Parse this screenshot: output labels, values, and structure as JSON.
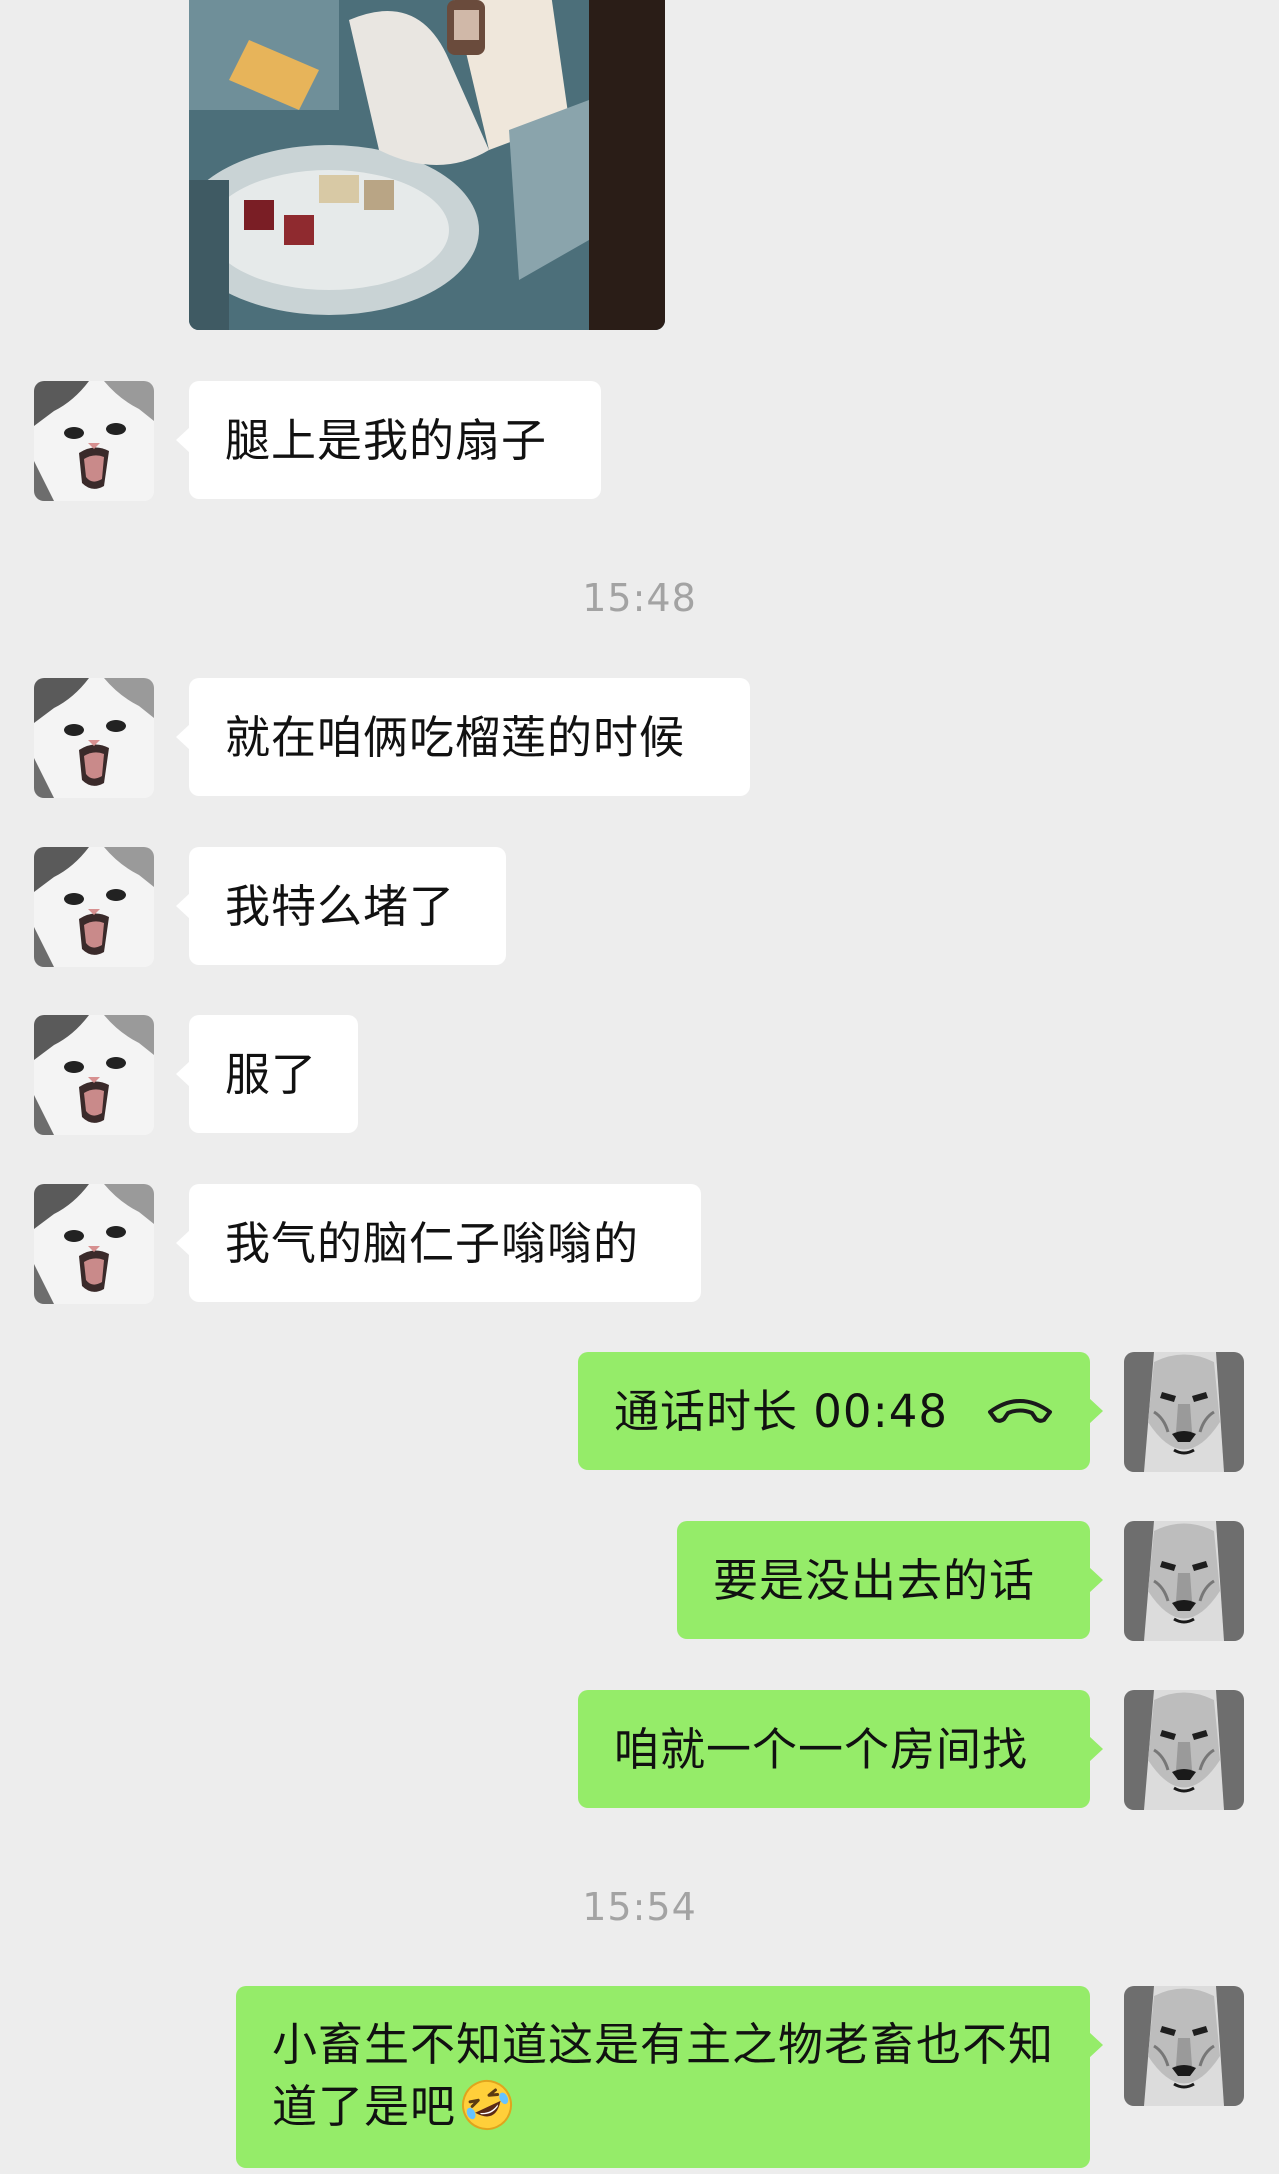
{
  "chat": {
    "timestamps": [
      "15:48",
      "15:54"
    ],
    "messages": [
      {
        "from": "contact",
        "text": "腿上是我的扇子"
      },
      {
        "from": "contact",
        "text": "就在咱俩吃榴莲的时候"
      },
      {
        "from": "contact",
        "text": "我特么堵了"
      },
      {
        "from": "contact",
        "text": "服了"
      },
      {
        "from": "contact",
        "text": "我气的脑仁子嗡嗡的"
      },
      {
        "from": "me",
        "type": "call",
        "text": "通话时长 00:48",
        "icon": "phone-hangup-icon"
      },
      {
        "from": "me",
        "text": "要是没出去的话"
      },
      {
        "from": "me",
        "text": "咱就一个一个房间找"
      },
      {
        "from": "me",
        "text": "小畜生不知道这是有主之物老畜也不知道了是吧",
        "emoji": "rolling-on-floor-laughing"
      }
    ]
  },
  "avatars": {
    "contact": "cat-avatar",
    "me": "lion-avatar"
  },
  "colors": {
    "background": "#ededed",
    "incoming_bubble": "#ffffff",
    "outgoing_bubble": "#95ec69",
    "timestamp": "#a3a3a3"
  }
}
